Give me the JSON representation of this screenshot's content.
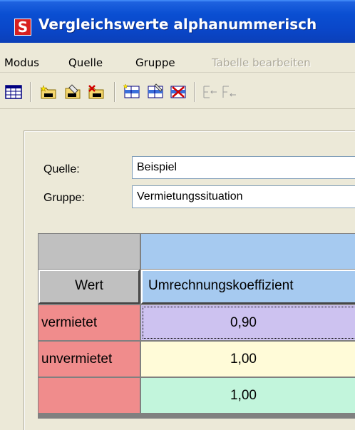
{
  "window": {
    "title": "Vergleichswerte alphanummerisch",
    "icon_letter": "S"
  },
  "menu": [
    {
      "label": "Modus",
      "enabled": true
    },
    {
      "label": "Quelle",
      "enabled": true
    },
    {
      "label": "Gruppe",
      "enabled": true
    },
    {
      "label": "Tabelle bearbeiten",
      "enabled": false
    }
  ],
  "toolbar": {
    "buttons": [
      "table-icon",
      "new-folder-icon",
      "edit-folder-icon",
      "delete-folder-icon",
      "new-row-icon",
      "edit-row-icon",
      "delete-row-icon",
      "insert-column-icon",
      "insert-column-icon"
    ]
  },
  "form": {
    "quelle_label": "Quelle:",
    "quelle_value": "Beispiel",
    "gruppe_label": "Gruppe:",
    "gruppe_value": "Vermietungssituation"
  },
  "table": {
    "column_headers": [
      "Wert",
      "Umrechnungskoeffizient"
    ],
    "rows": [
      {
        "wert": "vermietet",
        "value": "0,90",
        "color": "#CDC2F0"
      },
      {
        "wert": "unvermietet",
        "value": "1,00",
        "color": "#FFFBD8"
      },
      {
        "wert": "",
        "value": "1,00",
        "color": "#C2F5DC"
      }
    ],
    "row_header_color": "#F08C8C",
    "header_accent_color": "#A6CAF0"
  }
}
